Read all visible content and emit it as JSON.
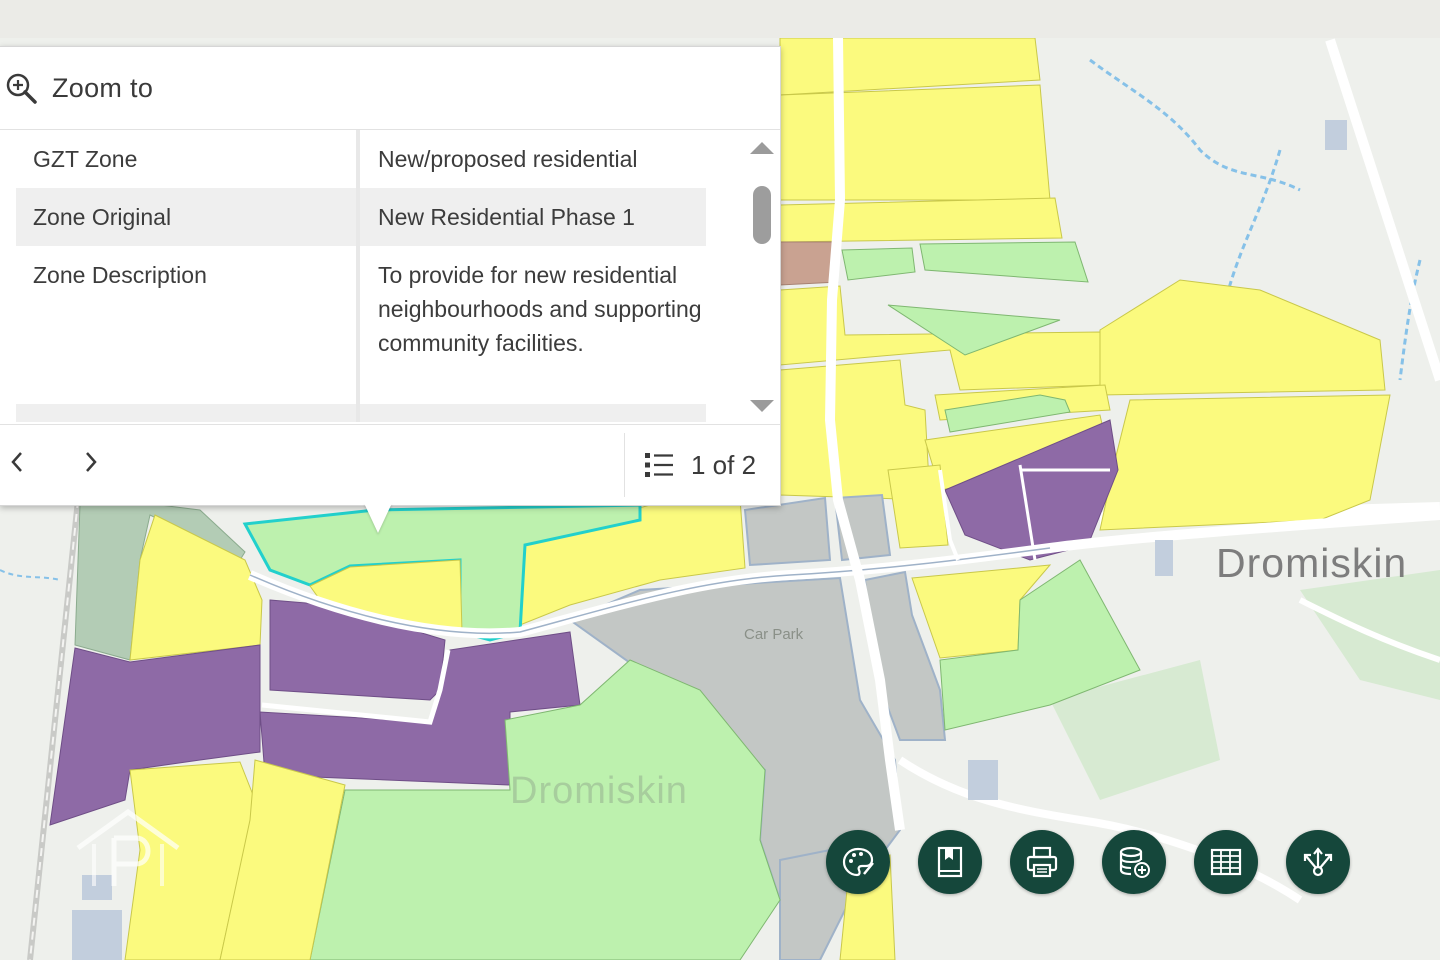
{
  "popup": {
    "zoom_label": "Zoom to",
    "attributes": [
      {
        "field": "GZT Zone",
        "value": "New/proposed residential"
      },
      {
        "field": "Zone Original",
        "value": "New Residential Phase 1"
      },
      {
        "field": "Zone Description",
        "value": "To provide for new residential neighbourhoods and supporting community facilities."
      }
    ],
    "pager": "1 of 2"
  },
  "map": {
    "labels": {
      "town_overlay": "Dromiskin",
      "town_base": "Dromiskin",
      "car_park": "Car Park"
    },
    "colors": {
      "residential": "#fbfa7e",
      "existing_residential": "#f4f17c",
      "open_space": "#bdf1ae",
      "town_centre": "#8e6aa6",
      "community": "#c3c7c5",
      "selected_outline": "#22d0cc",
      "commercial": "#c9a291"
    }
  },
  "toolbar": {
    "buttons": [
      {
        "name": "basemap-gallery-button",
        "icon": "palette-icon"
      },
      {
        "name": "bookmarks-button",
        "icon": "bookmark-icon"
      },
      {
        "name": "print-button",
        "icon": "printer-icon"
      },
      {
        "name": "add-data-button",
        "icon": "database-add-icon"
      },
      {
        "name": "attribute-table-button",
        "icon": "table-icon"
      },
      {
        "name": "share-button",
        "icon": "share-icon"
      }
    ],
    "accent": "#15473b"
  }
}
